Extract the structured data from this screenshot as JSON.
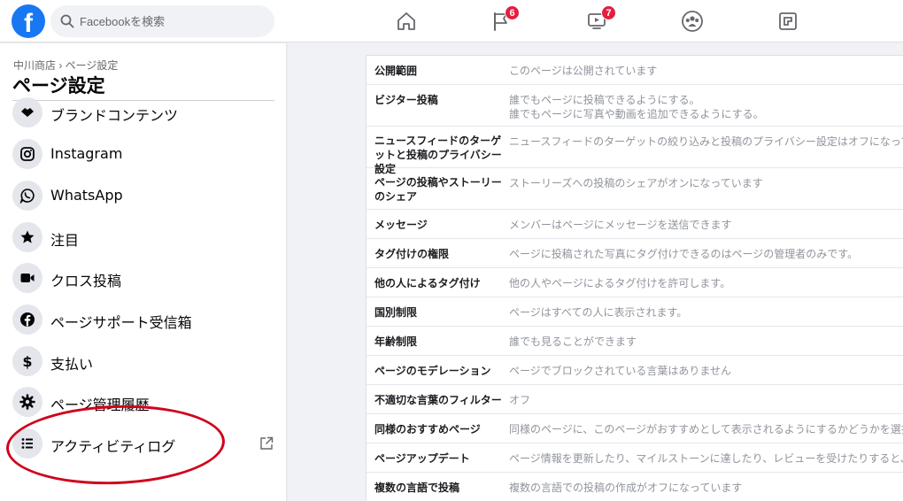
{
  "header": {
    "logo": "f",
    "search_placeholder": "Facebookを検索",
    "nav": [
      {
        "icon": "home-icon"
      },
      {
        "icon": "flag-icon",
        "badge": "6"
      },
      {
        "icon": "watch-icon",
        "badge": "7"
      },
      {
        "icon": "groups-icon"
      },
      {
        "icon": "gaming-icon"
      }
    ],
    "colors": {
      "brand": "#1877f2",
      "badge": "#e41e3f"
    }
  },
  "sidebar": {
    "breadcrumb": "中川商店 › ページ設定",
    "title": "ページ設定",
    "items": [
      {
        "label": "ブランドコンテンツ",
        "icon": "handshake-icon"
      },
      {
        "label": "Instagram",
        "icon": "instagram-icon"
      },
      {
        "label": "WhatsApp",
        "icon": "whatsapp-icon"
      },
      {
        "label": "注目",
        "icon": "star-icon"
      },
      {
        "label": "クロス投稿",
        "icon": "video-camera-icon"
      },
      {
        "label": "ページサポート受信箱",
        "icon": "facebook-icon"
      },
      {
        "label": "支払い",
        "icon": "dollar-icon"
      },
      {
        "label": "ページ管理履歴",
        "icon": "gear-icon"
      },
      {
        "label": "アクティビティログ",
        "icon": "list-icon",
        "external": true
      }
    ],
    "highlight_color": "#d0021b"
  },
  "settings": {
    "rows": [
      {
        "label": "公開範囲",
        "value": "このページは公開されています"
      },
      {
        "label": "ビジター投稿",
        "value": "誰でもページに投稿できるようにする。",
        "value2": "誰でもページに写真や動画を追加できるようにする。"
      },
      {
        "label": "ニュースフィードのターゲットと投稿のプライバシー設定",
        "value": "ニュースフィードのターゲットの絞り込みと投稿のプライバシー設定はオフになっています。"
      },
      {
        "label": "ページの投稿やストーリーのシェア",
        "value": "ストーリーズへの投稿のシェアがオンになっています"
      },
      {
        "label": "メッセージ",
        "value": "メンバーはページにメッセージを送信できます"
      },
      {
        "label": "タグ付けの権限",
        "value": "ページに投稿された写真にタグ付けできるのはページの管理者のみです。"
      },
      {
        "label": "他の人によるタグ付け",
        "value": "他の人やページによるタグ付けを許可します。"
      },
      {
        "label": "国別制限",
        "value": "ページはすべての人に表示されます。"
      },
      {
        "label": "年齢制限",
        "value": "誰でも見ることができます"
      },
      {
        "label": "ページのモデレーション",
        "value": "ページでブロックされている言葉はありません"
      },
      {
        "label": "不適切な言葉のフィルター",
        "value": "オフ"
      },
      {
        "label": "同様のおすすめページ",
        "value": "同様のページに、このページがおすすめとして表示されるようにするかどうかを選択できます"
      },
      {
        "label": "ページアップデート",
        "value": "ページ情報を更新したり、マイルストーンに達したり、レビューを受けたりすると、自動的に"
      },
      {
        "label": "複数の言語で投稿",
        "value": "複数の言語での投稿の作成がオフになっています"
      }
    ]
  }
}
